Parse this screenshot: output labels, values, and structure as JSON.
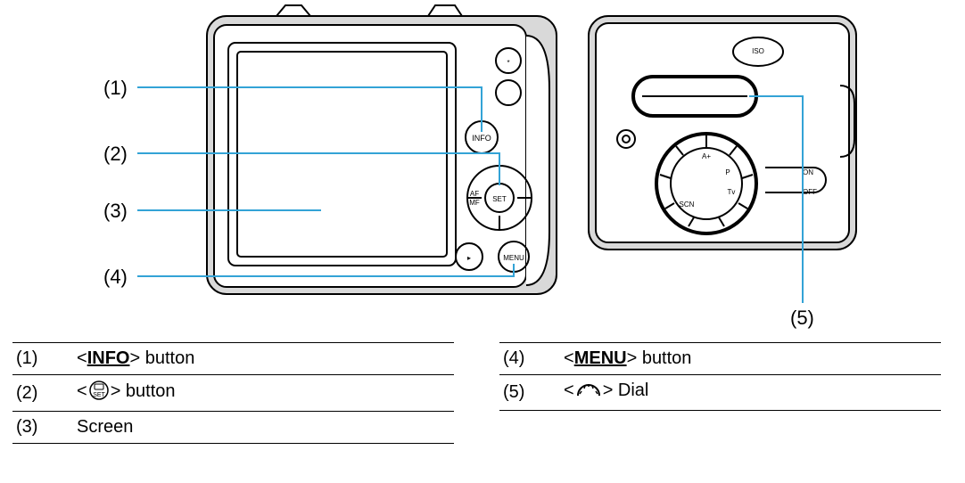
{
  "callouts": {
    "c1": "(1)",
    "c2": "(2)",
    "c3": "(3)",
    "c4": "(4)",
    "c5": "(5)"
  },
  "camera_back": {
    "buttons": {
      "info": "INFO",
      "menu": "MENU",
      "ael": "*",
      "play": "▸",
      "af_mf_l": "AF",
      "af_mf_b": "MF",
      "set": "SET",
      "iso": "ISO"
    },
    "power": {
      "on": "ON",
      "off": "OFF"
    }
  },
  "legend_left": [
    {
      "n": "(1)",
      "pre": "<",
      "sym": "INFO",
      "post": "> button"
    },
    {
      "n": "(2)",
      "pre": "<",
      "icon": "q-set",
      "post": "> button"
    },
    {
      "n": "(3)",
      "pre": "",
      "sym": "",
      "post": "Screen"
    }
  ],
  "legend_right": [
    {
      "n": "(4)",
      "pre": "<",
      "sym": "MENU",
      "post": "> button"
    },
    {
      "n": "(5)",
      "pre": "<",
      "icon": "dial",
      "post": "> Dial"
    }
  ]
}
